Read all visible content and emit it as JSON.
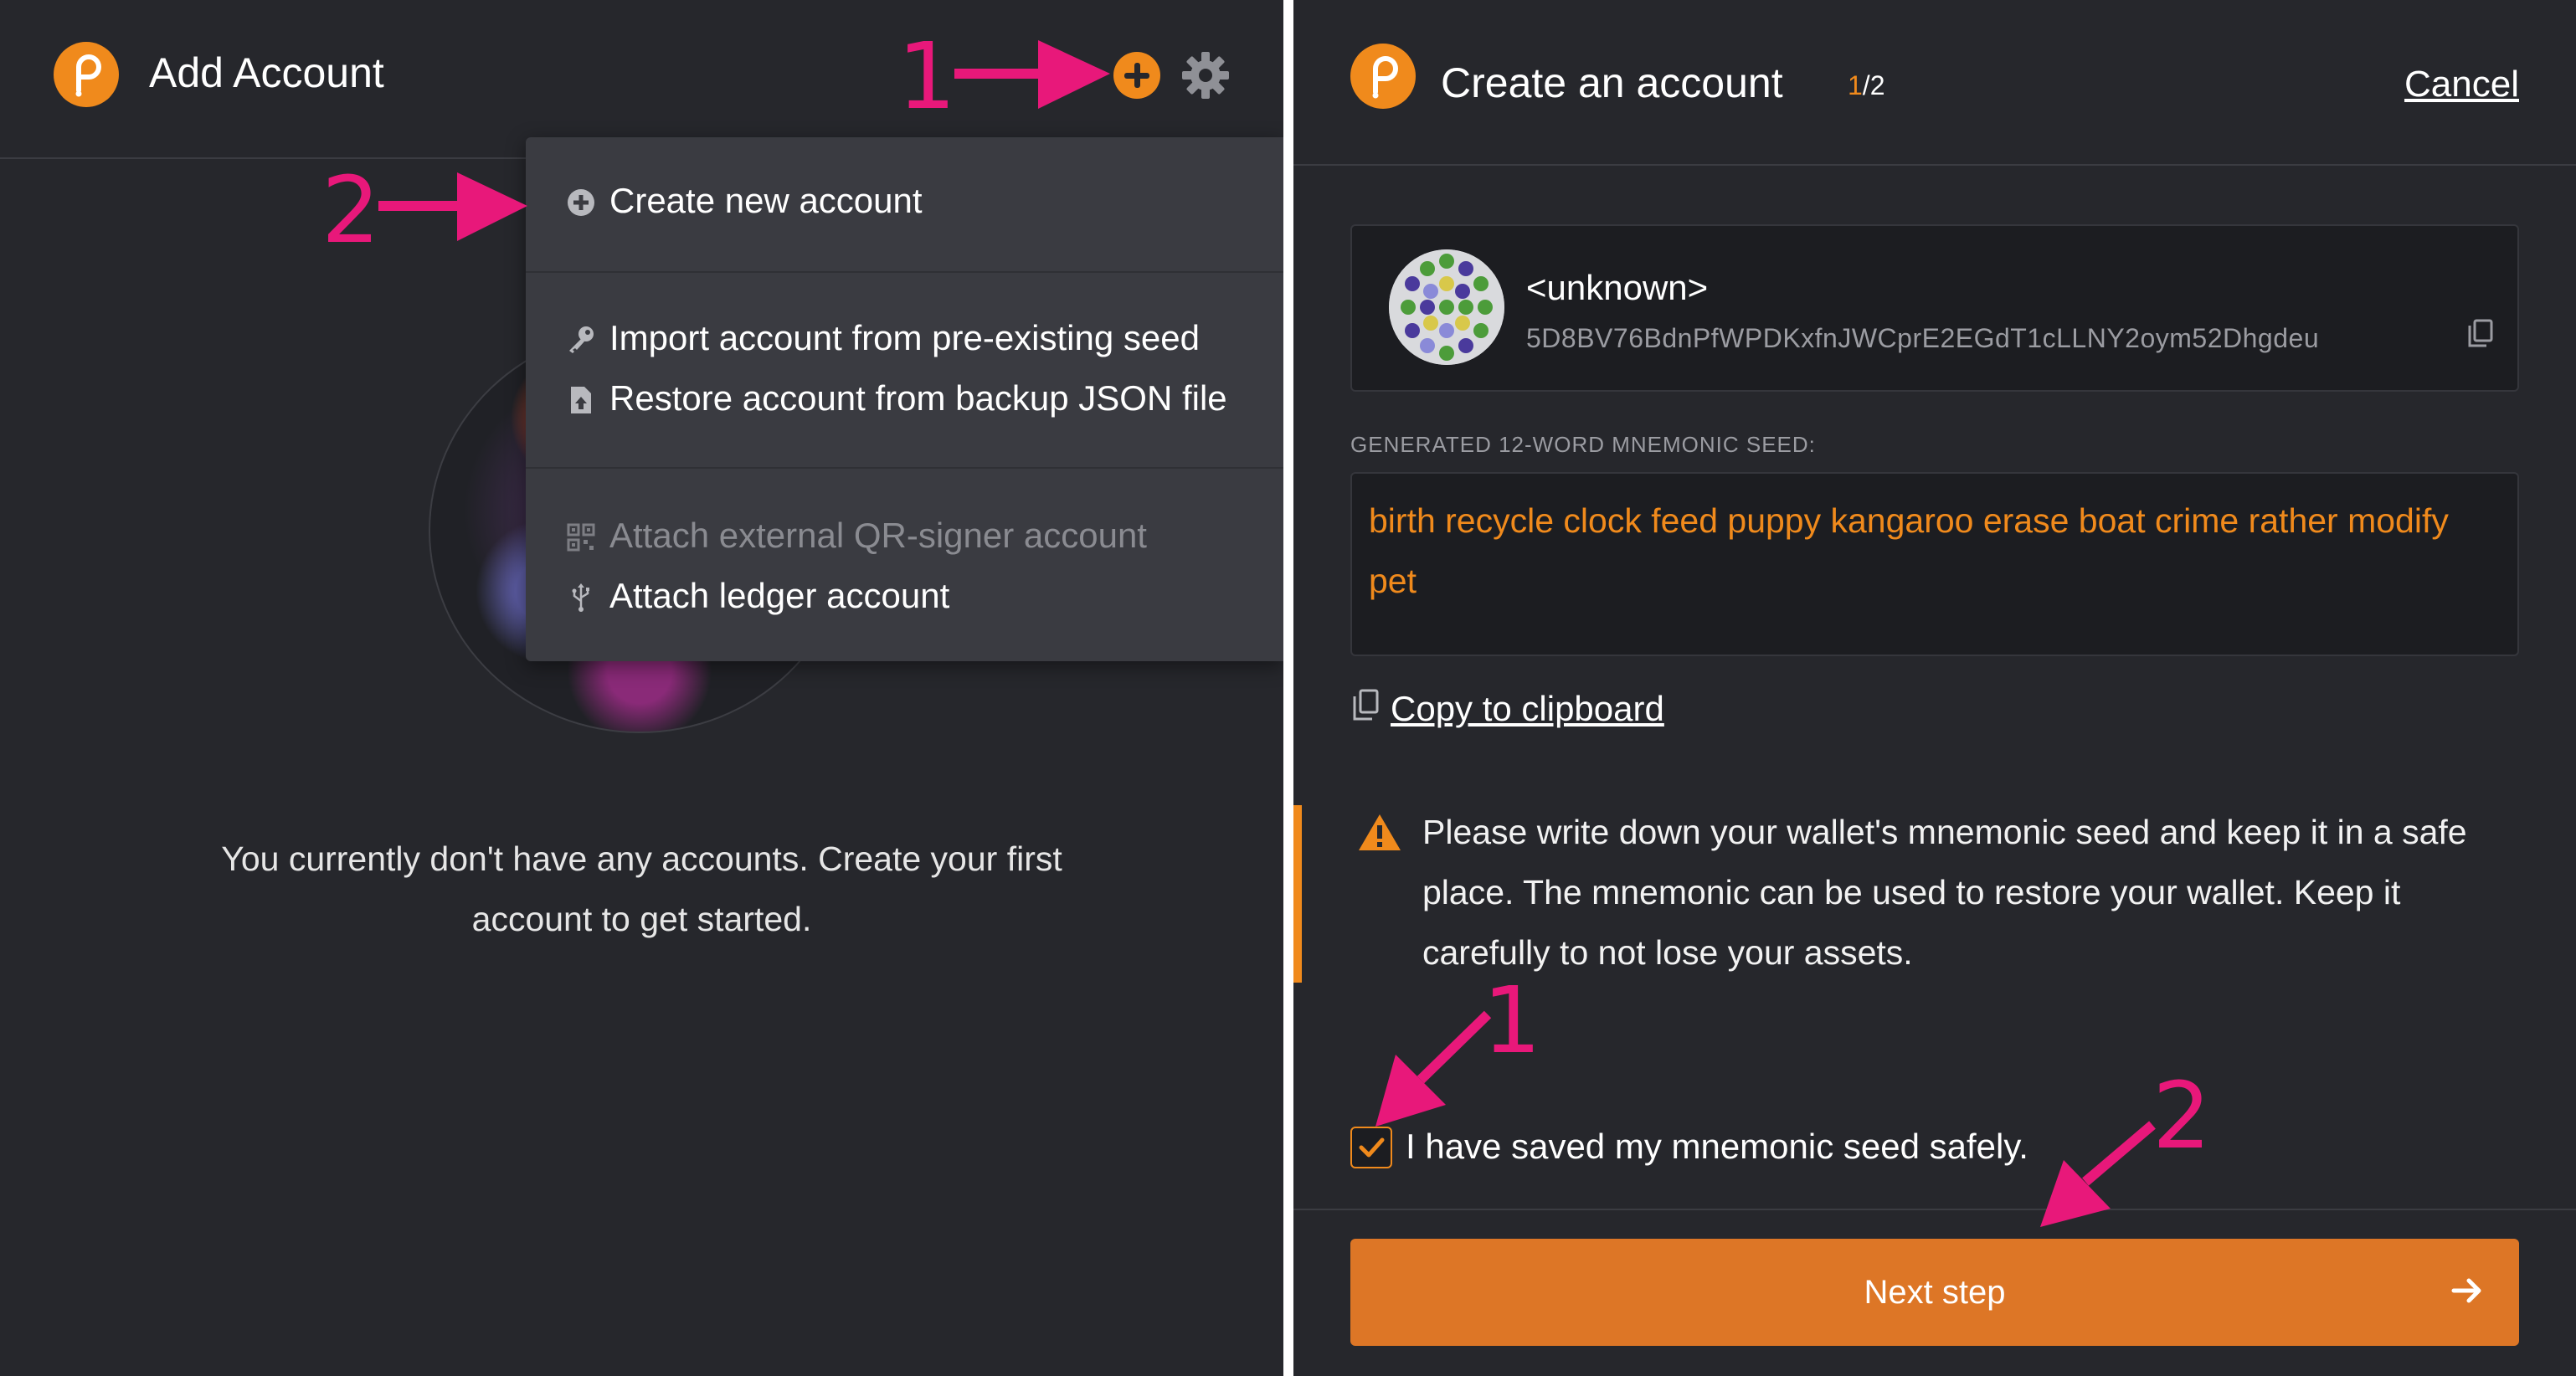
{
  "left": {
    "title": "Add Account",
    "menu": {
      "create": "Create new account",
      "import_seed": "Import account from pre-existing seed",
      "restore_json": "Restore account from backup JSON file",
      "attach_qr": "Attach external QR-signer account",
      "attach_ledger": "Attach ledger account"
    },
    "empty_message": "You currently don't have any accounts. Create your first account to get started.",
    "annotations": {
      "one": "1",
      "two": "2"
    }
  },
  "right": {
    "title": "Create an account",
    "step_current": "1",
    "step_total": "/2",
    "cancel": "Cancel",
    "account": {
      "name": "<unknown>",
      "address": "5D8BV76BdnPfWPDKxfnJWCprE2EGdT1cLLNY2oym52Dhgdeu"
    },
    "seed_label": "GENERATED 12-WORD MNEMONIC SEED:",
    "seed": "birth recycle clock feed puppy kangaroo erase boat crime rather modify pet",
    "copy_label": "Copy to clipboard",
    "warning": "Please write down your wallet's mnemonic seed and keep it in a safe place. The mnemonic can be used to restore your wallet. Keep it carefully to not lose your assets.",
    "checkbox_label": "I have saved my mnemonic seed safely.",
    "checkbox_checked": true,
    "next_label": "Next step",
    "annotations": {
      "one": "1",
      "two": "2"
    }
  },
  "colors": {
    "accent": "#f08a1c",
    "button": "#dd7626",
    "annotation": "#e8187a",
    "background": "#26272c"
  }
}
